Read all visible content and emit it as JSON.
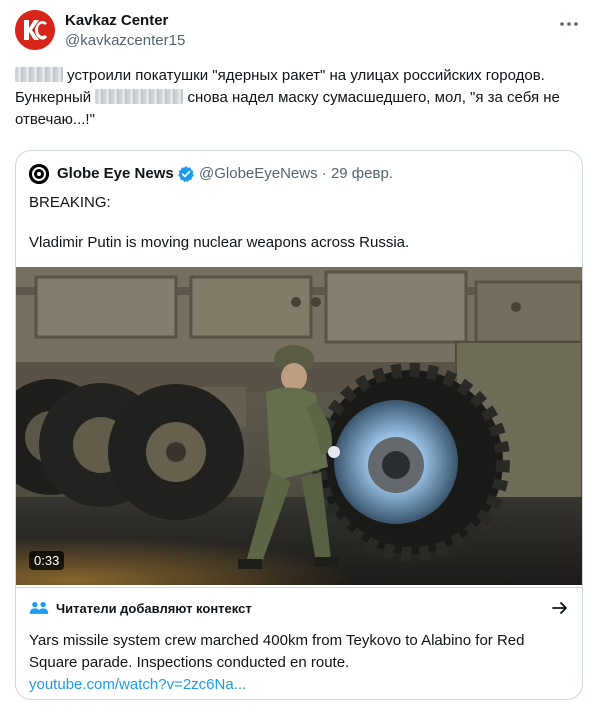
{
  "author": {
    "name": "Kavkaz Center",
    "handle": "@kavkazcenter15",
    "avatar_letters": "KC",
    "avatar_color": "#d8251c"
  },
  "tweet": {
    "part1": "устроили покатушки \"ядерных ракет\" на улицах российских городов. Бункерный",
    "part2": "снова надел маску сумасшедшего, мол, \"я за себя не отвечаю...!\""
  },
  "quoted": {
    "name": "Globe Eye News",
    "handle": "@GlobeEyeNews",
    "date": "· 29 февр.",
    "line1": "BREAKING:",
    "line2": "Vladimir Putin is moving nuclear weapons across Russia.",
    "video_duration": "0:33"
  },
  "community_note": {
    "title": "Читатели добавляют контекст",
    "text": "Yars missile system crew marched 400km from Teykovo to Alabino for Red Square parade. Inspections conducted en route.",
    "link": "youtube.com/watch?v=2zc6Na..."
  },
  "colors": {
    "link": "#1d9bf0",
    "verified": "#1d9bf0",
    "border": "#cfd9de",
    "secondary_text": "#536471"
  }
}
